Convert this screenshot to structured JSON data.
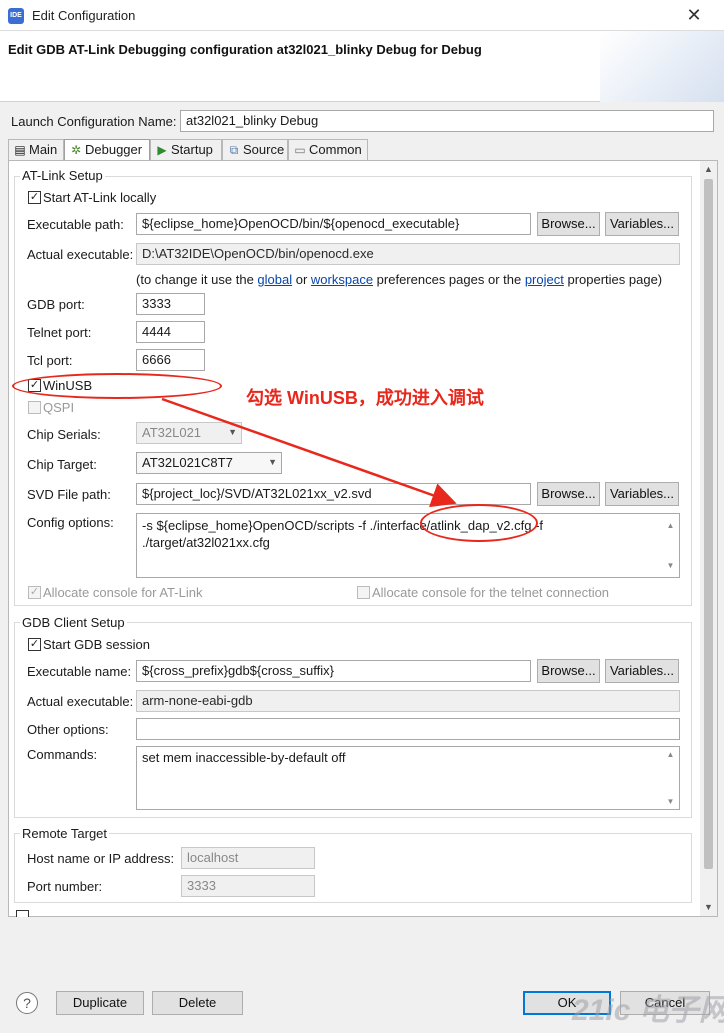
{
  "window": {
    "title": "Edit Configuration",
    "app_icon_text": "IDE",
    "close": "✕"
  },
  "header": {
    "title": "Edit GDB AT-Link Debugging configuration at32l021_blinky Debug for Debug"
  },
  "launch": {
    "label": "Launch Configuration Name:",
    "value": "at32l021_blinky Debug"
  },
  "tabs": [
    {
      "label": "Main",
      "icon": "main-tab-icon"
    },
    {
      "label": "Debugger",
      "icon": "debugger-tab-icon"
    },
    {
      "label": "Startup",
      "icon": "startup-tab-icon"
    },
    {
      "label": "Source",
      "icon": "source-tab-icon"
    },
    {
      "label": "Common",
      "icon": "common-tab-icon"
    }
  ],
  "atlink": {
    "group_title": "AT-Link Setup",
    "start_locally": {
      "label": "Start AT-Link locally",
      "checked": true
    },
    "exec_path": {
      "label": "Executable path:",
      "value": "${eclipse_home}OpenOCD/bin/${openocd_executable}"
    },
    "browse": "Browse...",
    "variables": "Variables...",
    "actual_exec": {
      "label": "Actual executable:",
      "value": "D:\\AT32IDE\\OpenOCD/bin/openocd.exe"
    },
    "hint": {
      "pre": "(to change it use the ",
      "global": "global",
      "or": " or ",
      "workspace": "workspace",
      "mid": " preferences pages or the ",
      "project": "project",
      "post": " properties page)"
    },
    "gdb_port": {
      "label": "GDB port:",
      "value": "3333"
    },
    "telnet_port": {
      "label": "Telnet port:",
      "value": "4444"
    },
    "tcl_port": {
      "label": "Tcl port:",
      "value": "6666"
    },
    "winusb": {
      "label": "WinUSB",
      "checked": true
    },
    "qspi": {
      "label": "QSPI",
      "checked": false
    },
    "chip_serials": {
      "label": "Chip Serials:",
      "value": "AT32L021"
    },
    "chip_target": {
      "label": "Chip Target:",
      "value": "AT32L021C8T7"
    },
    "svd": {
      "label": "SVD File path:",
      "value": "${project_loc}/SVD/AT32L021xx_v2.svd"
    },
    "config": {
      "label": "Config options:",
      "line1": "-s ${eclipse_home}OpenOCD/scripts -f ./interface/atlink_dap_v2.cfg -f",
      "line2": "./target/at32l021xx.cfg"
    },
    "alloc_console": {
      "label": "Allocate console for AT-Link",
      "checked": true
    },
    "alloc_telnet": {
      "label": "Allocate console for the telnet connection",
      "checked": false
    }
  },
  "annotation": {
    "text": "勾选 WinUSB，成功进入调试",
    "color": "#e8281c"
  },
  "gdbclient": {
    "group_title": "GDB Client Setup",
    "start_session": {
      "label": "Start GDB session",
      "checked": true
    },
    "exec_name": {
      "label": "Executable name:",
      "value": "${cross_prefix}gdb${cross_suffix}"
    },
    "browse": "Browse...",
    "variables": "Variables...",
    "actual_exec": {
      "label": "Actual executable:",
      "value": "arm-none-eabi-gdb"
    },
    "other": {
      "label": "Other options:",
      "value": ""
    },
    "commands": {
      "label": "Commands:",
      "value": "set mem inaccessible-by-default off"
    }
  },
  "remote": {
    "group_title": "Remote Target",
    "host": {
      "label": "Host name or IP address:",
      "value": "localhost"
    },
    "port": {
      "label": "Port number:",
      "value": "3333"
    }
  },
  "footer": {
    "help": "?",
    "duplicate": "Duplicate",
    "delete": "Delete",
    "ok": "OK",
    "cancel": "Cancel",
    "watermark": "21ic 电子网"
  }
}
